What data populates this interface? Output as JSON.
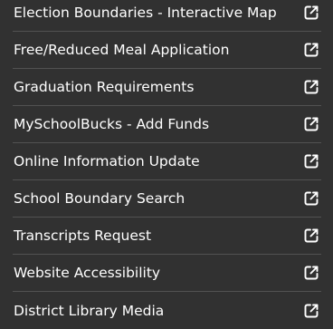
{
  "links": [
    {
      "label": "Election Boundaries - Interactive Map",
      "icon": "external-link-icon"
    },
    {
      "label": "Free/Reduced Meal Application",
      "icon": "external-link-icon"
    },
    {
      "label": "Graduation Requirements",
      "icon": "external-link-icon"
    },
    {
      "label": "MySchoolBucks - Add Funds",
      "icon": "external-link-icon"
    },
    {
      "label": "Online Information Update",
      "icon": "external-link-icon"
    },
    {
      "label": "School Boundary Search",
      "icon": "external-link-icon"
    },
    {
      "label": "Transcripts Request",
      "icon": "external-link-icon"
    },
    {
      "label": "Website Accessibility",
      "icon": "external-link-icon"
    },
    {
      "label": "District Library Media",
      "icon": "external-link-icon"
    }
  ],
  "colors": {
    "background": "#313131",
    "text": "#ffffff",
    "divider": "#525252"
  }
}
